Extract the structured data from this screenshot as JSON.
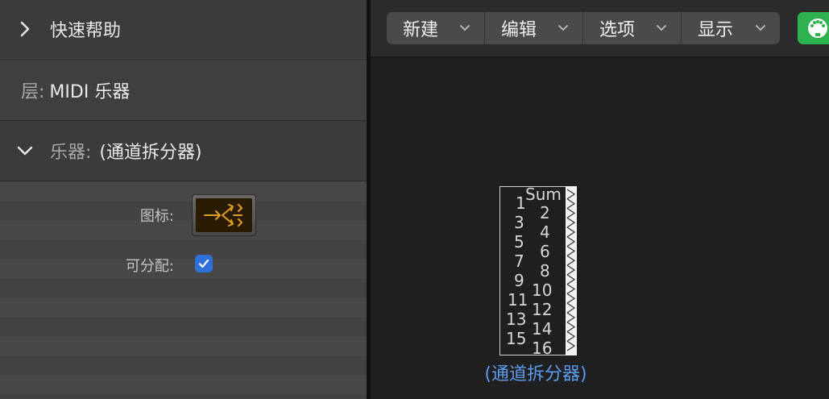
{
  "inspector": {
    "quick_help": "快速帮助",
    "layer_label": "层:",
    "layer_value": "MIDI 乐器",
    "instrument_label": "乐器:",
    "instrument_value": "(通道拆分器)",
    "icon_label": "图标:",
    "assignable_label": "可分配:",
    "assignable_checked": true
  },
  "toolbar": {
    "menus": [
      "新建",
      "编辑",
      "选项",
      "显示"
    ]
  },
  "object": {
    "name": "(通道拆分器)",
    "sum_label": "Sum",
    "outputs_left": [
      "1",
      "3",
      "5",
      "7",
      "9",
      "11",
      "13",
      "15"
    ],
    "outputs_right": [
      "2",
      "4",
      "6",
      "8",
      "10",
      "12",
      "14",
      "16"
    ]
  },
  "colors": {
    "accent_blue": "#2f6fd8",
    "name_blue": "#5d9cf0",
    "green": "#2eb14f",
    "icon_orange": "#e0a020"
  }
}
